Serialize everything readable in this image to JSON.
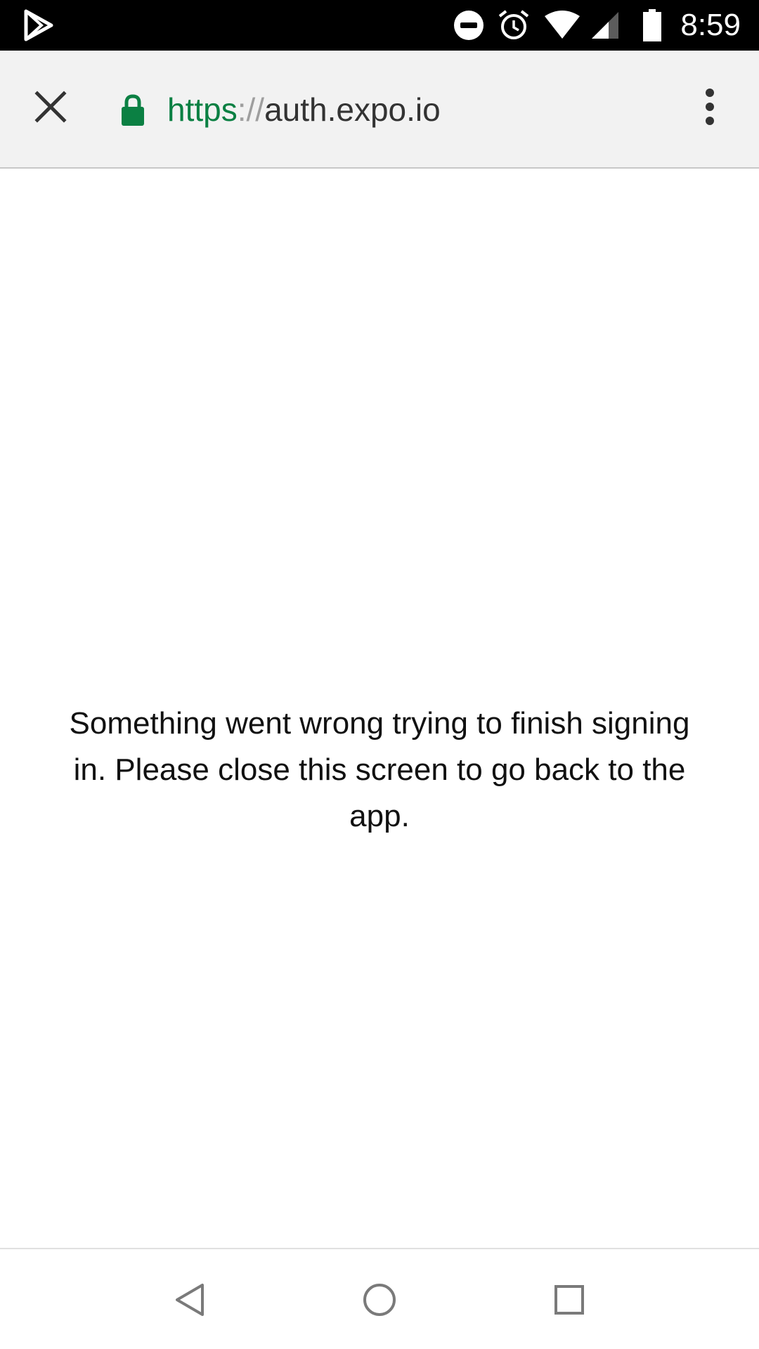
{
  "status_bar": {
    "time": "8:59",
    "icons": [
      "play-store-icon",
      "do-not-disturb-icon",
      "alarm-icon",
      "wifi-icon",
      "signal-icon",
      "battery-icon"
    ]
  },
  "toolbar": {
    "close_icon": "close-icon",
    "lock_icon": "lock-icon",
    "url_scheme": "https",
    "url_separator": "://",
    "url_host": "auth.expo.io",
    "menu_icon": "more-vert-icon",
    "colors": {
      "secure": "#0b8043",
      "background": "#f2f2f2"
    }
  },
  "main": {
    "message": "Something went wrong trying to finish signing in. Please close this screen to go back to the app."
  },
  "nav_bar": {
    "icons": [
      "back-icon",
      "home-icon",
      "recents-icon"
    ]
  }
}
